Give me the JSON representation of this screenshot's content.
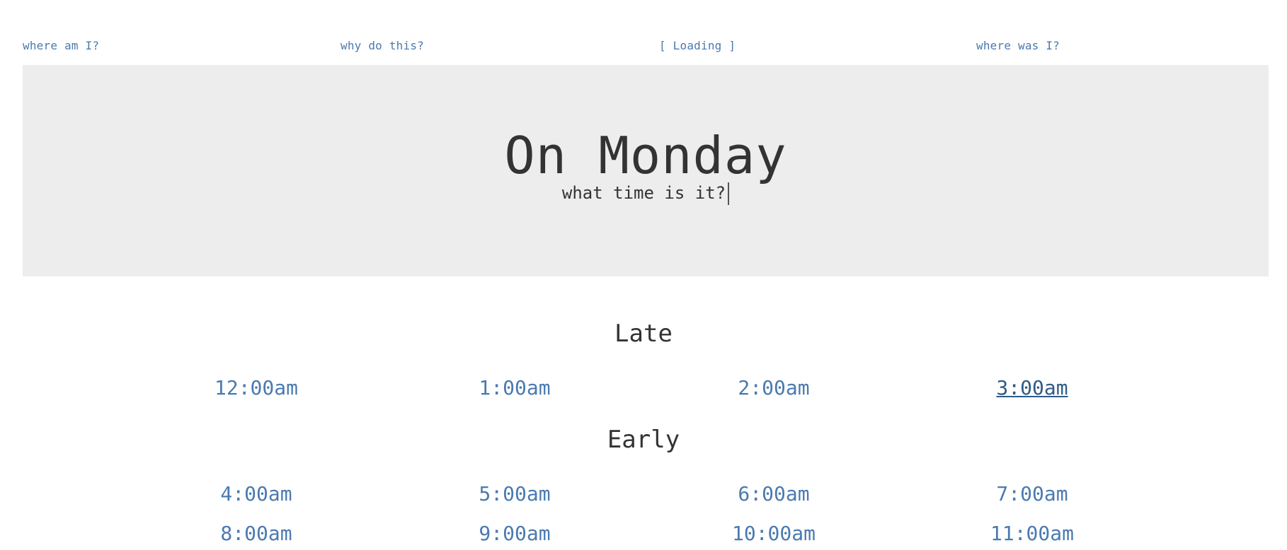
{
  "nav": {
    "where_am_i": "where am I?",
    "why": "why do this?",
    "loading": "[ Loading ]",
    "where_was_i": "where was I?"
  },
  "hero": {
    "title": "On Monday",
    "subtitle": "what time is it?"
  },
  "sections": {
    "late": {
      "heading": "Late",
      "times": [
        "12:00am",
        "1:00am",
        "2:00am",
        "3:00am"
      ]
    },
    "early": {
      "heading": "Early",
      "times": [
        "4:00am",
        "5:00am",
        "6:00am",
        "7:00am"
      ],
      "times_next": [
        "8:00am",
        "9:00am",
        "10:00am",
        "11:00am"
      ]
    }
  },
  "colors": {
    "link": "#4a7ab0",
    "active_link": "#2f5a86",
    "hero_bg": "#ededed",
    "text": "#333333"
  },
  "active_time": "3:00am"
}
